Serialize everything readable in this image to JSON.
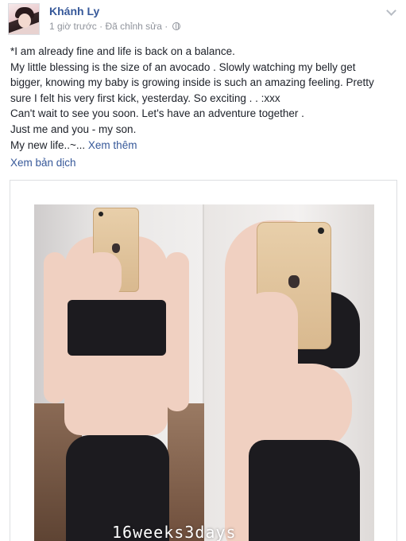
{
  "author": {
    "name": "Khánh Ly"
  },
  "meta": {
    "time": "1 giờ trước",
    "separator1": " · ",
    "edited": "Đã chỉnh sửa",
    "separator2": " · "
  },
  "post": {
    "lines": [
      "*I am already fine and life is back on a balance.",
      "My little blessing is the size of an avocado . Slowly watching my belly get",
      "bigger, knowing my baby is growing inside is such an amazing feeling. Pretty",
      "sure I felt his very first kick, yesterday. So exciting . . :xxx",
      "Can't wait to see you soon. Let's have an adventure together .",
      "Just me and you - my son."
    ],
    "last_line_prefix": "My new life..~... ",
    "see_more": "Xem thêm",
    "translate": "Xem bản dịch"
  },
  "photo": {
    "watermark": "16weeks3days"
  },
  "icons": {
    "menu": "chevron-down-icon",
    "privacy": "globe-icon"
  },
  "colors": {
    "link": "#365899",
    "meta": "#90949c",
    "text": "#1d2129"
  }
}
